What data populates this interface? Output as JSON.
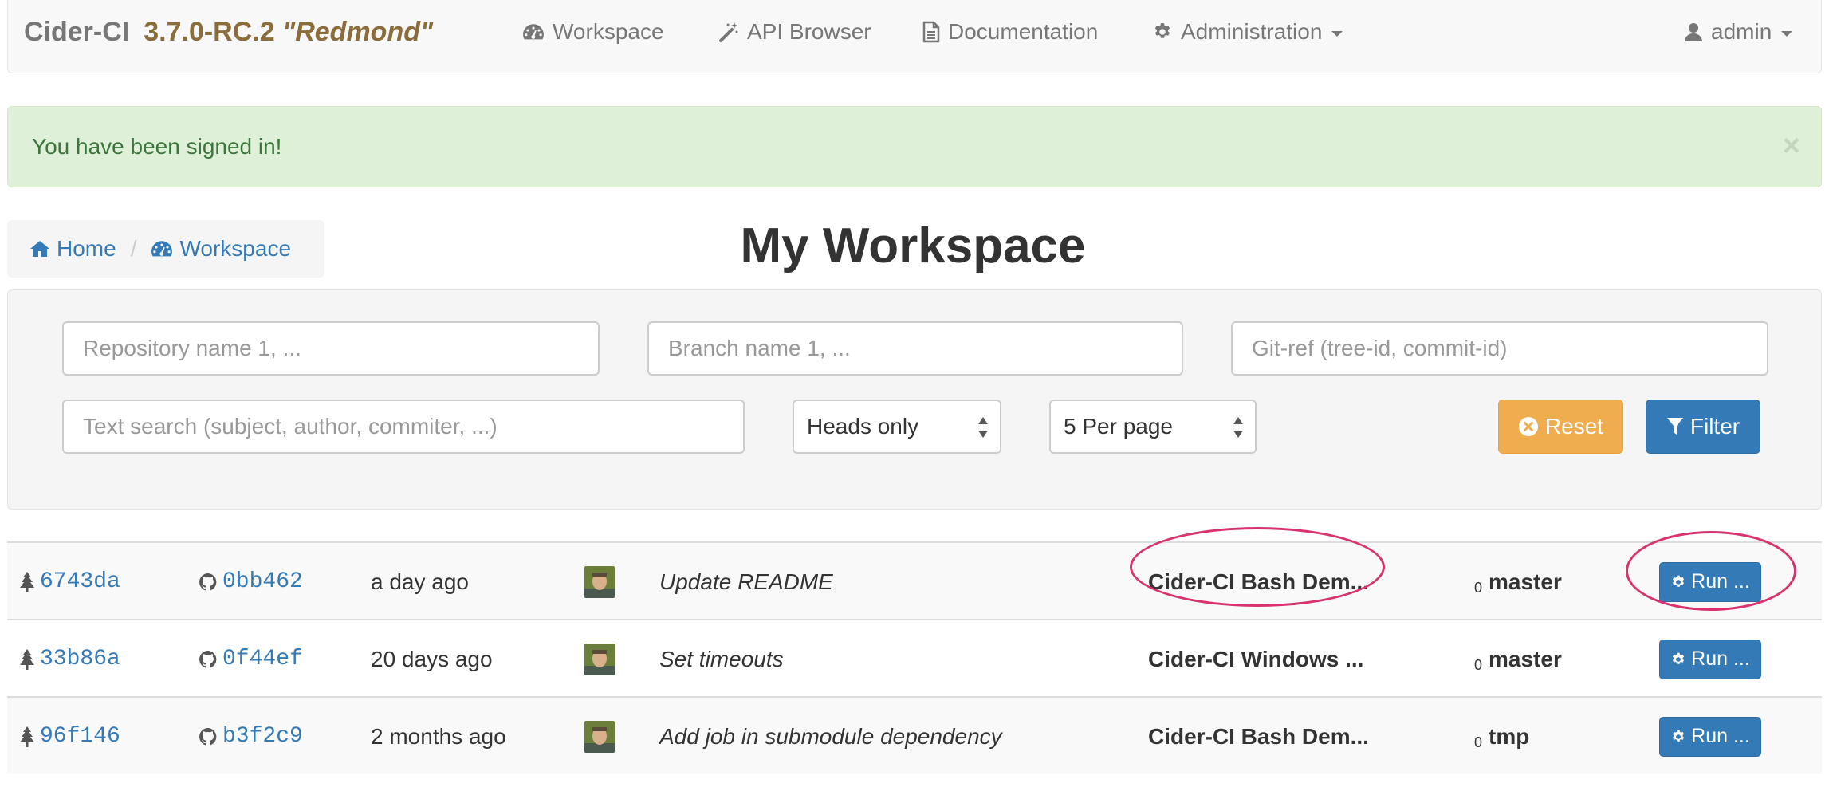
{
  "navbar": {
    "brand_name": "Cider-CI",
    "version": "3.7.0-RC.2",
    "codename": "\"Redmond\"",
    "items": [
      {
        "label": "Workspace",
        "icon": "dashboard-icon"
      },
      {
        "label": "API Browser",
        "icon": "magic-wand-icon"
      },
      {
        "label": "Documentation",
        "icon": "file-icon"
      },
      {
        "label": "Administration",
        "icon": "gear-icon"
      }
    ],
    "user": "admin"
  },
  "alert": {
    "message": "You have been signed in!",
    "close_symbol": "×"
  },
  "breadcrumb": {
    "home_label": "Home",
    "workspace_label": "Workspace",
    "separator": "/"
  },
  "page_title": "My Workspace",
  "filters": {
    "repository_placeholder": "Repository name 1, ...",
    "branch_placeholder": "Branch name 1, ...",
    "gitref_placeholder": "Git-ref (tree-id, commit-id)",
    "text_search_placeholder": "Text search (subject, author, commiter, ...)",
    "heads_select": "Heads only",
    "per_page_select": "5 Per page",
    "reset_label": "Reset",
    "filter_label": "Filter"
  },
  "commits": [
    {
      "tree_id": "6743da",
      "commit_id": "0bb462",
      "time": "a day ago",
      "subject": "Update README",
      "project": "Cider-CI Bash Dem...",
      "depth": "0",
      "branch": "master",
      "run_label": "Run ..."
    },
    {
      "tree_id": "33b86a",
      "commit_id": "0f44ef",
      "time": "20 days ago",
      "subject": "Set timeouts",
      "project": "Cider-CI Windows ...",
      "depth": "0",
      "branch": "master",
      "run_label": "Run ..."
    },
    {
      "tree_id": "96f146",
      "commit_id": "b3f2c9",
      "time": "2 months ago",
      "subject": "Add job in submodule dependency",
      "project": "Cider-CI Bash Dem...",
      "depth": "0",
      "branch": "tmp",
      "run_label": "Run ..."
    }
  ],
  "colors": {
    "link": "#337ab7",
    "alert_bg": "#dff0d8",
    "alert_text": "#3c763d",
    "reset_button": "#f0ad4e",
    "filter_button": "#337ab7",
    "highlight_ellipse": "#d9336f",
    "brand_version": "#8a6d3b"
  }
}
